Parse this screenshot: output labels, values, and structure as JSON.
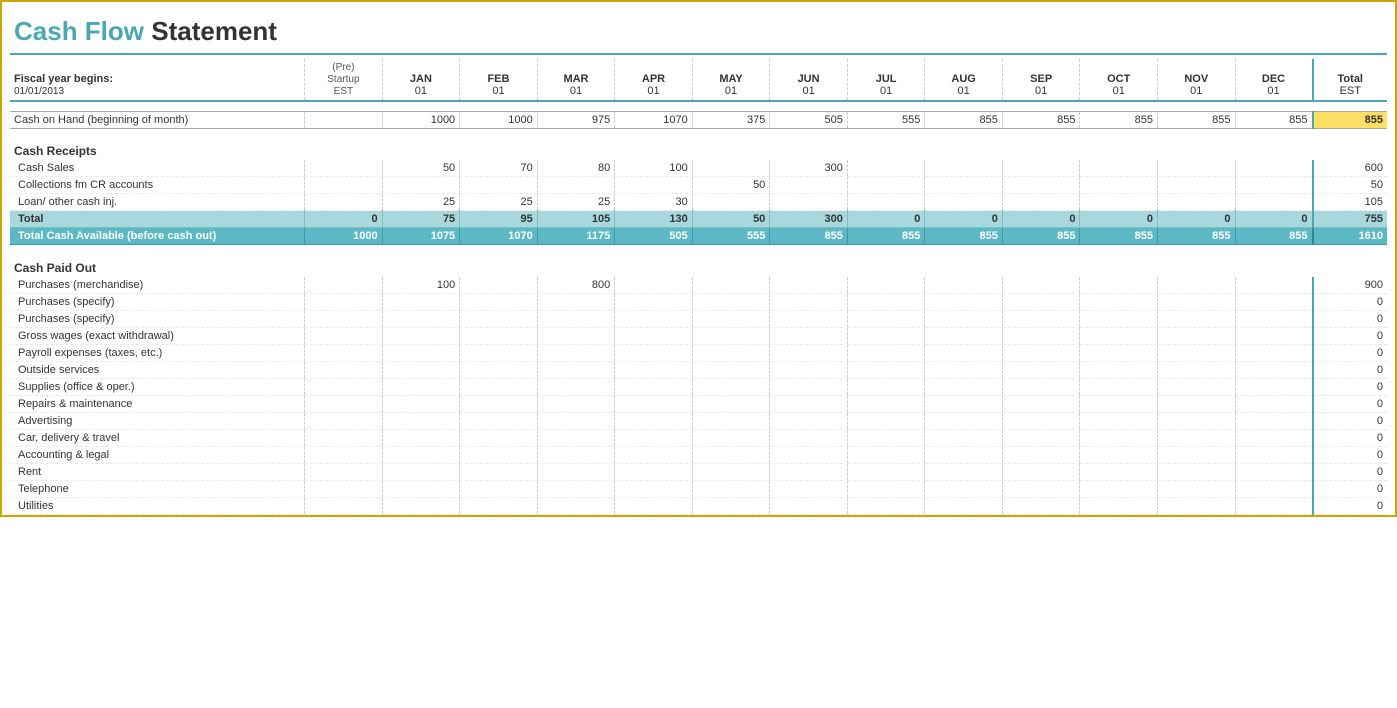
{
  "title": {
    "cash_flow": "Cash Flow",
    "statement": "Statement"
  },
  "fiscal": {
    "label": "Fiscal year begins:",
    "date": "01/01/2013",
    "pre_startup": "(Pre) Startup EST"
  },
  "columns": [
    {
      "id": "startup",
      "label": "(Pre)\nStartup",
      "sub": "EST"
    },
    {
      "id": "jan",
      "label": "JAN",
      "sub": "01"
    },
    {
      "id": "feb",
      "label": "FEB",
      "sub": "01"
    },
    {
      "id": "mar",
      "label": "MAR",
      "sub": "01"
    },
    {
      "id": "apr",
      "label": "APR",
      "sub": "01"
    },
    {
      "id": "may",
      "label": "MAY",
      "sub": "01"
    },
    {
      "id": "jun",
      "label": "JUN",
      "sub": "01"
    },
    {
      "id": "jul",
      "label": "JUL",
      "sub": "01"
    },
    {
      "id": "aug",
      "label": "AUG",
      "sub": "01"
    },
    {
      "id": "sep",
      "label": "SEP",
      "sub": "01"
    },
    {
      "id": "oct",
      "label": "OCT",
      "sub": "01"
    },
    {
      "id": "nov",
      "label": "NOV",
      "sub": "01"
    },
    {
      "id": "dec",
      "label": "DEC",
      "sub": "01"
    },
    {
      "id": "total",
      "label": "Total",
      "sub": "EST"
    }
  ],
  "cash_on_hand": {
    "label": "Cash on Hand (beginning of month)",
    "values": [
      "",
      "1000",
      "1000",
      "975",
      "1070",
      "375",
      "505",
      "555",
      "855",
      "855",
      "855",
      "855",
      "855",
      "855"
    ],
    "total": "855"
  },
  "sections": {
    "receipts": {
      "label": "Cash Receipts",
      "rows": [
        {
          "label": "Cash Sales",
          "values": [
            "",
            "50",
            "70",
            "80",
            "100",
            "",
            "300",
            "",
            "",
            "",
            "",
            "",
            ""
          ],
          "total": "600"
        },
        {
          "label": "Collections fm CR accounts",
          "values": [
            "",
            "",
            "",
            "",
            "",
            "50",
            "",
            "",
            "",
            "",
            "",
            "",
            ""
          ],
          "total": "50"
        },
        {
          "label": "Loan/ other cash inj.",
          "values": [
            "",
            "25",
            "25",
            "25",
            "30",
            "",
            "",
            "",
            "",
            "",
            "",
            "",
            ""
          ],
          "total": "105"
        }
      ],
      "total_row": {
        "label": "Total",
        "values": [
          "0",
          "75",
          "95",
          "105",
          "130",
          "50",
          "300",
          "0",
          "0",
          "0",
          "0",
          "0",
          "0"
        ],
        "total": "755"
      },
      "grand_total_row": {
        "label": "Total Cash Available (before cash out)",
        "values": [
          "1000",
          "1075",
          "1070",
          "1175",
          "505",
          "555",
          "855",
          "855",
          "855",
          "855",
          "855",
          "855",
          "855"
        ],
        "total": "1610"
      }
    },
    "paid_out": {
      "label": "Cash Paid Out",
      "rows": [
        {
          "label": "Purchases (merchandise)",
          "values": [
            "",
            "100",
            "",
            "800",
            "",
            "",
            "",
            "",
            "",
            "",
            "",
            "",
            ""
          ],
          "total": "900"
        },
        {
          "label": "Purchases (specify)",
          "values": [
            "",
            "",
            "",
            "",
            "",
            "",
            "",
            "",
            "",
            "",
            "",
            "",
            ""
          ],
          "total": "0"
        },
        {
          "label": "Purchases (specify)",
          "values": [
            "",
            "",
            "",
            "",
            "",
            "",
            "",
            "",
            "",
            "",
            "",
            "",
            ""
          ],
          "total": "0"
        },
        {
          "label": "Gross wages (exact withdrawal)",
          "values": [
            "",
            "",
            "",
            "",
            "",
            "",
            "",
            "",
            "",
            "",
            "",
            "",
            ""
          ],
          "total": "0"
        },
        {
          "label": "Payroll expenses (taxes, etc.)",
          "values": [
            "",
            "",
            "",
            "",
            "",
            "",
            "",
            "",
            "",
            "",
            "",
            "",
            ""
          ],
          "total": "0"
        },
        {
          "label": "Outside services",
          "values": [
            "",
            "",
            "",
            "",
            "",
            "",
            "",
            "",
            "",
            "",
            "",
            "",
            ""
          ],
          "total": "0"
        },
        {
          "label": "Supplies (office & oper.)",
          "values": [
            "",
            "",
            "",
            "",
            "",
            "",
            "",
            "",
            "",
            "",
            "",
            "",
            ""
          ],
          "total": "0"
        },
        {
          "label": "Repairs & maintenance",
          "values": [
            "",
            "",
            "",
            "",
            "",
            "",
            "",
            "",
            "",
            "",
            "",
            "",
            ""
          ],
          "total": "0"
        },
        {
          "label": "Advertising",
          "values": [
            "",
            "",
            "",
            "",
            "",
            "",
            "",
            "",
            "",
            "",
            "",
            "",
            ""
          ],
          "total": "0"
        },
        {
          "label": "Car, delivery & travel",
          "values": [
            "",
            "",
            "",
            "",
            "",
            "",
            "",
            "",
            "",
            "",
            "",
            "",
            ""
          ],
          "total": "0"
        },
        {
          "label": "Accounting & legal",
          "values": [
            "",
            "",
            "",
            "",
            "",
            "",
            "",
            "",
            "",
            "",
            "",
            "",
            ""
          ],
          "total": "0"
        },
        {
          "label": "Rent",
          "values": [
            "",
            "",
            "",
            "",
            "",
            "",
            "",
            "",
            "",
            "",
            "",
            "",
            ""
          ],
          "total": "0"
        },
        {
          "label": "Telephone",
          "values": [
            "",
            "",
            "",
            "",
            "",
            "",
            "",
            "",
            "",
            "",
            "",
            "",
            ""
          ],
          "total": "0"
        },
        {
          "label": "Utilities",
          "values": [
            "",
            "",
            "",
            "",
            "",
            "",
            "",
            "",
            "",
            "",
            "",
            "",
            ""
          ],
          "total": "0"
        }
      ]
    }
  }
}
